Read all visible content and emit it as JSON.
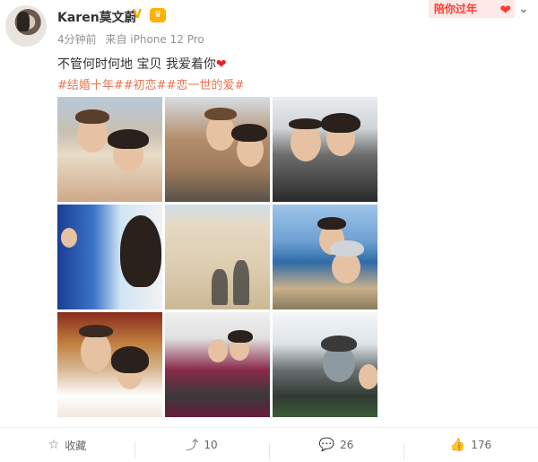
{
  "header": {
    "user_name": "Karen莫文蔚",
    "verified_icon": "V",
    "vip_icon": "♛",
    "time": "4分钟前",
    "source": "来自 iPhone 12 Pro",
    "promo": "陪你过年",
    "promo_icon": "❤"
  },
  "post": {
    "text": "不管何时何地 宝贝 我爱着你",
    "heart_emoji": "❤",
    "tags": "#结婚十年##初恋##恋一世的爱#"
  },
  "footer": {
    "favorite_label": "收藏",
    "repost_count": "10",
    "comment_count": "26",
    "like_count": "176"
  },
  "colors": {
    "tag_color": "#eb7350",
    "promo_color": "#ff3b30"
  }
}
